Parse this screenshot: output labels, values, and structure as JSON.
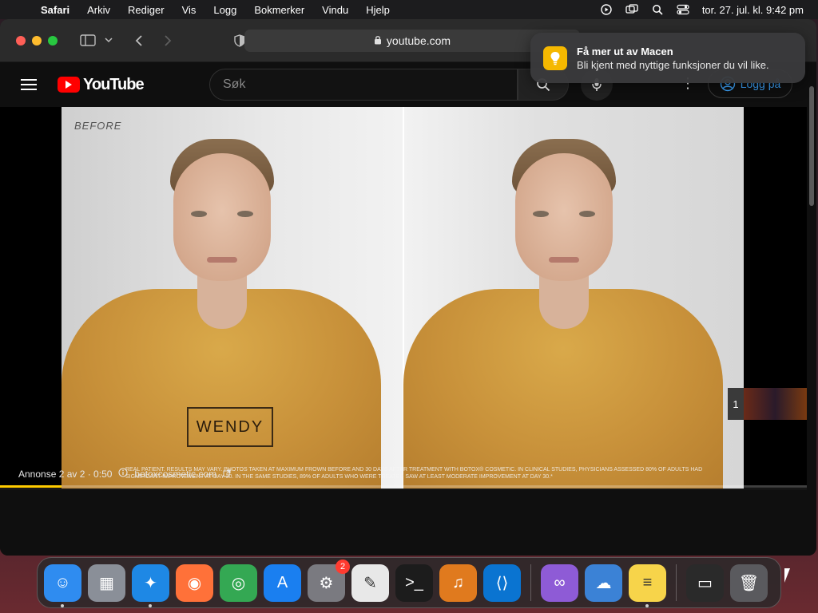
{
  "menubar": {
    "app_name": "Safari",
    "items": [
      "Arkiv",
      "Rediger",
      "Vis",
      "Logg",
      "Bokmerker",
      "Vindu",
      "Hjelp"
    ],
    "clock": "tor. 27. jul. kl. 9:42 pm"
  },
  "safari": {
    "url": "youtube.com"
  },
  "notification": {
    "title": "Få mer ut av Macen",
    "body": "Bli kjent med nyttige funksjoner du vil like."
  },
  "youtube": {
    "logo_text": "YouTube",
    "search_placeholder": "Søk",
    "login_label": "Logg på"
  },
  "video": {
    "before_label": "BEFORE",
    "name_label": "WENDY",
    "disclaimer": "REAL PATIENT. RESULTS MAY VARY. PHOTOS TAKEN AT MAXIMUM FROWN BEFORE AND 30 DAYS AFTER TREATMENT WITH BOTOX® COSMETIC. IN CLINICAL STUDIES, PHYSICIANS ASSESSED 80% OF ADULTS HAD SIGNIFICANT IMPROVEMENT AT DAY 30. IN THE SAME STUDIES, 89% OF ADULTS WHO WERE TREATED SAW AT LEAST MODERATE IMPROVEMENT AT DAY 30.*",
    "ad_counter": "Annonse 2 av 2 · 0:50",
    "ad_link": "botoxcosmetic.com",
    "ad_progress_fraction": 0.076,
    "queue_count": "1"
  },
  "dock": {
    "apps": [
      {
        "name": "finder",
        "glyph": "☺",
        "color": "#2f8cf0",
        "running": true
      },
      {
        "name": "launchpad",
        "glyph": "▦",
        "color": "#8a8f98",
        "running": false
      },
      {
        "name": "safari",
        "glyph": "✦",
        "color": "#1e88e5",
        "running": true
      },
      {
        "name": "firefox",
        "glyph": "◉",
        "color": "#ff7139",
        "running": false
      },
      {
        "name": "chrome",
        "glyph": "◎",
        "color": "#34a853",
        "running": false
      },
      {
        "name": "app-store",
        "glyph": "A",
        "color": "#1a7ff0",
        "running": false
      },
      {
        "name": "system-settings",
        "glyph": "⚙",
        "color": "#7a7a80",
        "running": false,
        "badge": "2"
      },
      {
        "name": "textedit",
        "glyph": "✎",
        "color": "#e8e8e8",
        "running": false
      },
      {
        "name": "terminal",
        "glyph": ">_",
        "color": "#1c1c1c",
        "running": false
      },
      {
        "name": "garageband",
        "glyph": "♫",
        "color": "#e07a1e",
        "running": false
      },
      {
        "name": "vscode",
        "glyph": "⟨⟩",
        "color": "#0a74d1",
        "running": false
      },
      {
        "name": "visual-studio",
        "glyph": "∞",
        "color": "#8e5bd6",
        "running": false
      },
      {
        "name": "weather",
        "glyph": "☁",
        "color": "#3b82d6",
        "running": false
      },
      {
        "name": "notes",
        "glyph": "≡",
        "color": "#f7d44a",
        "running": true
      },
      {
        "name": "preview-window",
        "glyph": "▭",
        "color": "#2a2a2a",
        "running": false
      },
      {
        "name": "trash",
        "glyph": "🗑",
        "color": "#5a5a5e",
        "running": false
      }
    ]
  }
}
